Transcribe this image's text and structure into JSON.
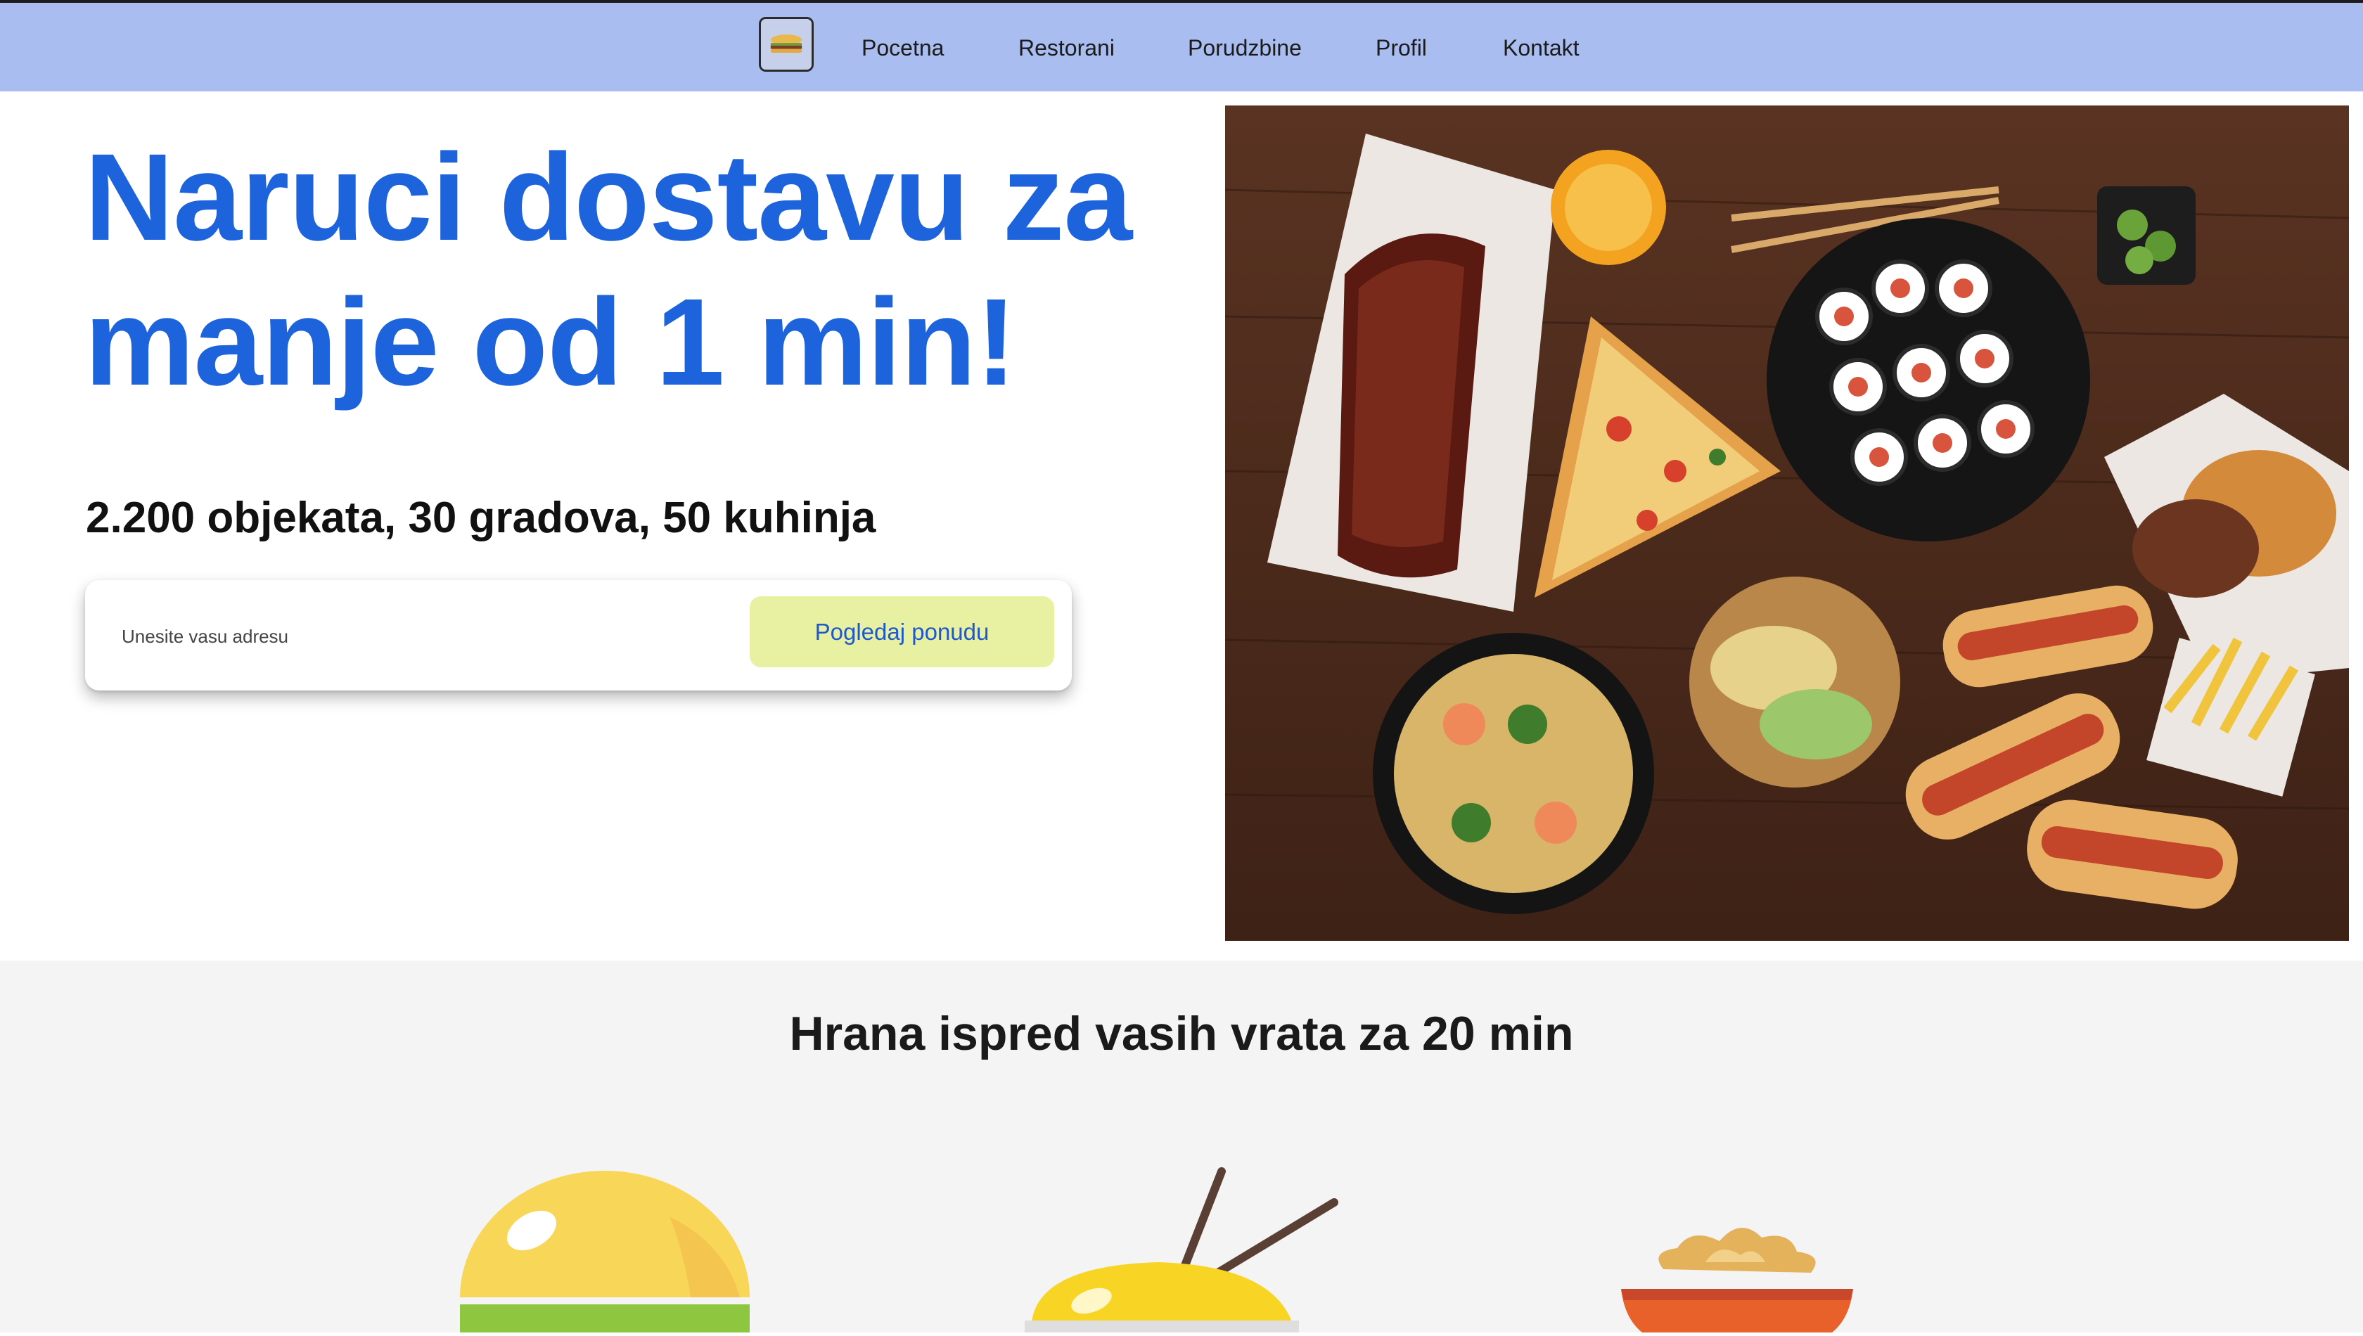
{
  "nav": {
    "logo_icon": "burger-logo-icon",
    "links": [
      "Pocetna",
      "Restorani",
      "Porudzbine",
      "Profil",
      "Kontakt"
    ]
  },
  "hero": {
    "headline": "Naruci dostavu za manje od 1 min!",
    "subline": "2.200 objekata, 30 gradova, 50 kuhinja",
    "search": {
      "placeholder": "Unesite vasu adresu",
      "button_label": "Pogledaj ponudu"
    },
    "image_icon": "food-spread-image"
  },
  "features": {
    "title": "Hrana ispred vasih vrata za 20 min",
    "icons": [
      "burger-icon",
      "noodle-bowl-icon",
      "soup-bowl-icon"
    ]
  },
  "colors": {
    "navbar": "#a9bdf0",
    "headline": "#1d63dc",
    "button_bg": "#e8f0a2",
    "button_text": "#1d58d0",
    "section_bg": "#f4f4f4"
  }
}
